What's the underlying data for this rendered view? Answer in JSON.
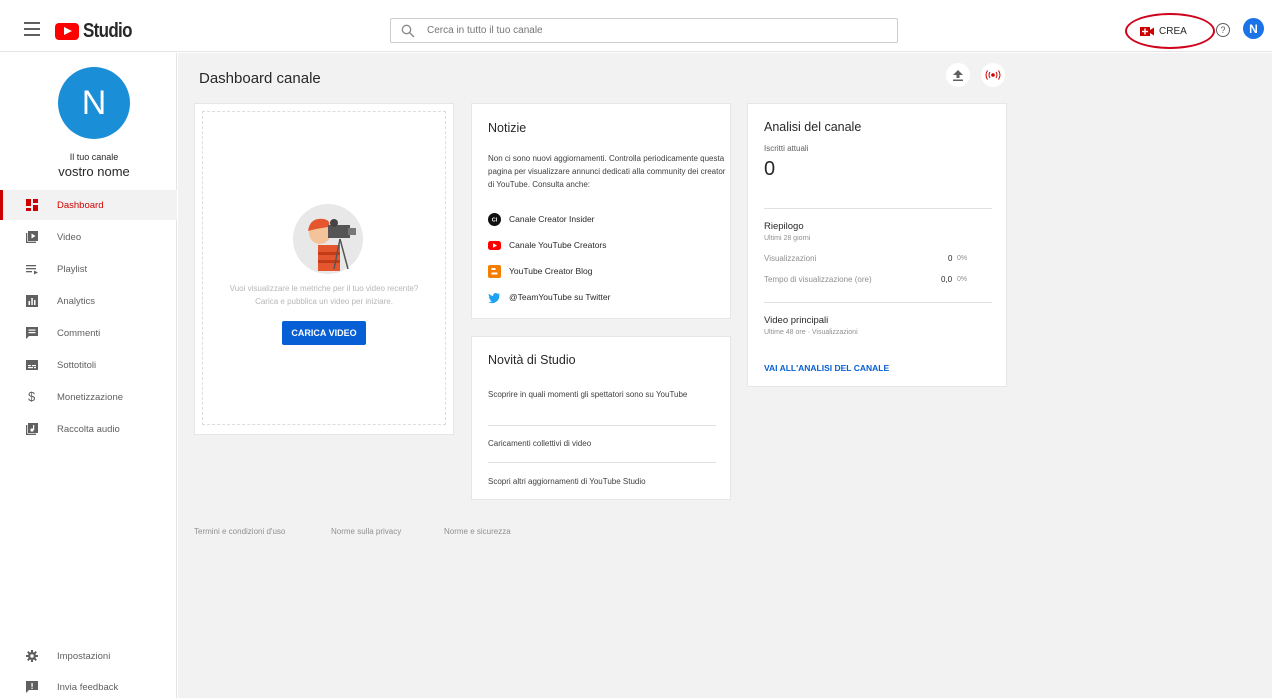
{
  "header": {
    "logo_text": "Studio",
    "search_placeholder": "Cerca in tutto il tuo canale",
    "create_label": "CREA",
    "help_label": "?",
    "avatar_letter": "N"
  },
  "sidebar": {
    "avatar_letter": "N",
    "channel_label": "Il tuo canale",
    "channel_name": "vostro nome",
    "items": [
      {
        "label": "Dashboard",
        "icon": "dashboard-icon"
      },
      {
        "label": "Video",
        "icon": "video-icon"
      },
      {
        "label": "Playlist",
        "icon": "playlist-icon"
      },
      {
        "label": "Analytics",
        "icon": "analytics-icon"
      },
      {
        "label": "Commenti",
        "icon": "comments-icon"
      },
      {
        "label": "Sottotitoli",
        "icon": "subtitles-icon"
      },
      {
        "label": "Monetizzazione",
        "icon": "dollar-icon"
      },
      {
        "label": "Raccolta audio",
        "icon": "audio-library-icon"
      }
    ],
    "bottom_items": [
      {
        "label": "Impostazioni",
        "icon": "gear-icon"
      },
      {
        "label": "Invia feedback",
        "icon": "feedback-icon"
      }
    ]
  },
  "main": {
    "title": "Dashboard canale",
    "upload_card": {
      "line1": "Vuoi visualizzare le metriche per il tuo video recente?",
      "line2": "Carica e pubblica un video per iniziare.",
      "button": "CARICA VIDEO"
    },
    "news_card": {
      "title": "Notizie",
      "text": "Non ci sono nuovi aggiornamenti. Controlla periodicamente questa pagina per visualizzare annunci dedicati alla community dei creator di YouTube. Consulta anche:",
      "links": [
        {
          "label": "Canale Creator Insider",
          "icon": "creator-insider-icon"
        },
        {
          "label": "Canale YouTube Creators",
          "icon": "youtube-icon"
        },
        {
          "label": "YouTube Creator Blog",
          "icon": "blogger-icon"
        },
        {
          "label": "@TeamYouTube su Twitter",
          "icon": "twitter-icon"
        }
      ]
    },
    "studio_card": {
      "title": "Novità di Studio",
      "items": [
        "Scoprire in quali momenti gli spettatori sono su YouTube",
        "Caricamenti collettivi di video",
        "Scopri altri aggiornamenti di YouTube Studio"
      ]
    },
    "analytics_card": {
      "title": "Analisi del canale",
      "subs_label": "Iscritti attuali",
      "subs_value": "0",
      "summary_title": "Riepilogo",
      "summary_period": "Ultimi 28 giorni",
      "rows": [
        {
          "label": "Visualizzazioni",
          "value": "0",
          "pct": "0%"
        },
        {
          "label": "Tempo di visualizzazione (ore)",
          "value": "0,0",
          "pct": "0%"
        }
      ],
      "top_title": "Video principali",
      "top_period": "Ultime 48 ore · Visualizzazioni",
      "link": "VAI ALL'ANALISI DEL CANALE"
    },
    "footer": [
      "Termini e condizioni d'uso",
      "Norme sulla privacy",
      "Norme e sicurezza"
    ]
  }
}
